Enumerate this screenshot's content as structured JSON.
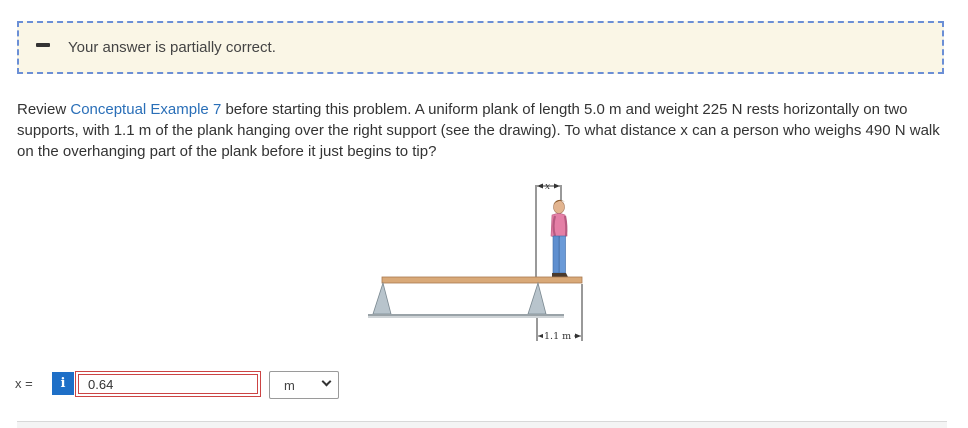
{
  "feedback": {
    "message": "Your answer is partially correct.",
    "status_icon": "partial-dash-icon"
  },
  "problem": {
    "intro": "Review ",
    "link_text": "Conceptual Example 7",
    "body": " before starting this problem. A uniform plank of length 5.0 m and weight 225 N rests horizontally on two supports, with 1.1 m of the plank hanging over the right support (see the drawing). To what distance x can a person who weighs 490 N walk on the overhanging part of the plank before it just begins to tip?"
  },
  "figure": {
    "x_label": "x",
    "overhang_label": "1.1 m"
  },
  "answer": {
    "variable_label": "x =",
    "info_label": "i",
    "value": "0.64",
    "unit": "m"
  },
  "colors": {
    "link": "#2a6fb8",
    "feedback_bg": "#faf6e6",
    "feedback_border": "#6b8fd6",
    "info_button": "#1e6fc7",
    "error_border": "#cc4444"
  }
}
